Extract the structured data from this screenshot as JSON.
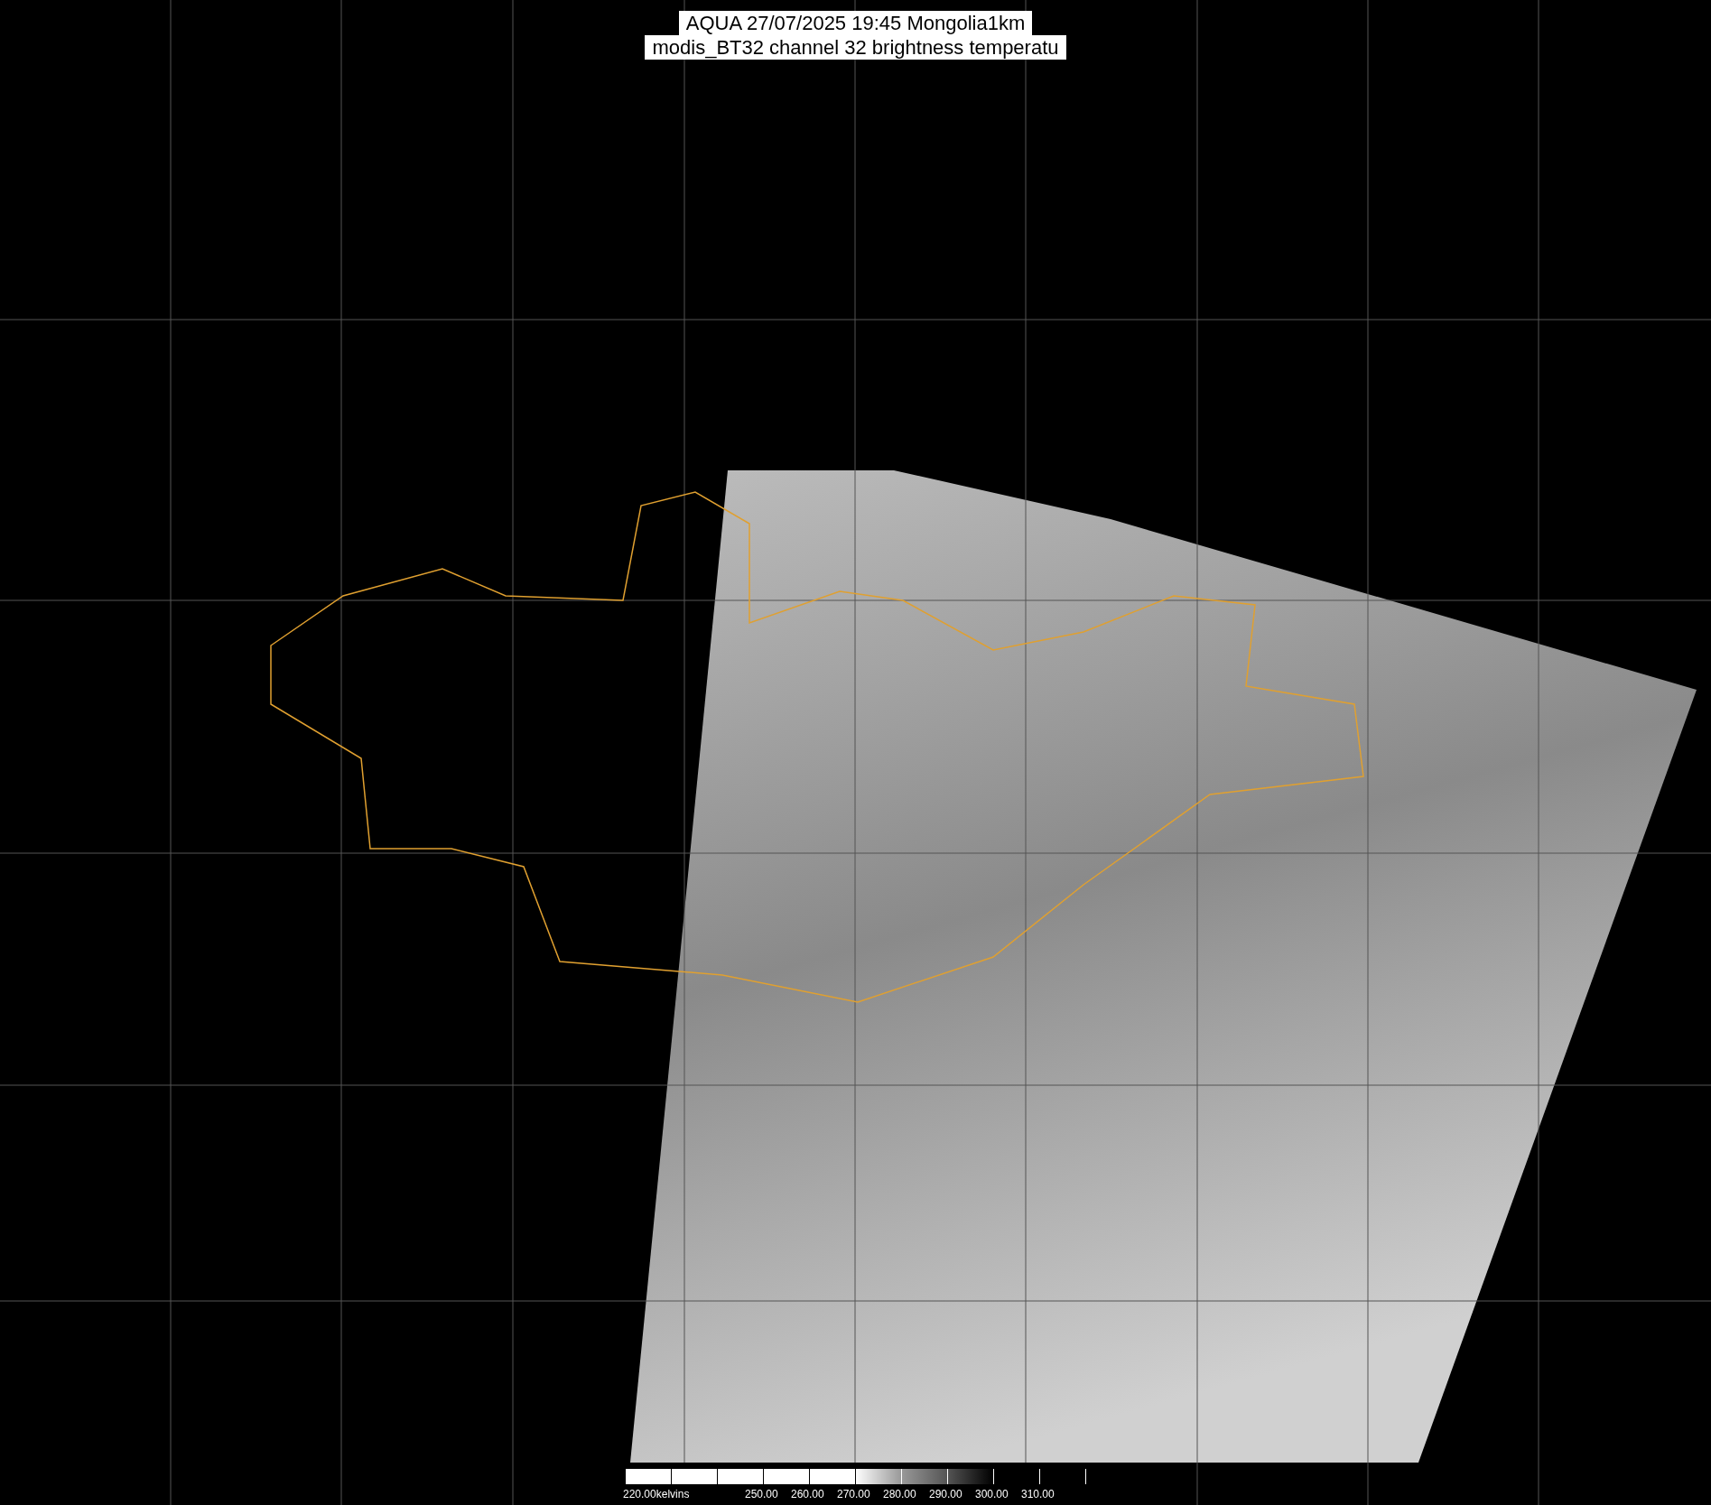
{
  "title_lines": [
    "AQUA 27/07/2025 19:45 Mongolia1km",
    "modis_BT32 channel 32 brightness temperatu"
  ],
  "colorbar": {
    "tick_labels": [
      "220.00kelvins",
      "250.00",
      "260.00",
      "270.00",
      "280.00",
      "290.00",
      "300.00",
      "310.00"
    ]
  }
}
